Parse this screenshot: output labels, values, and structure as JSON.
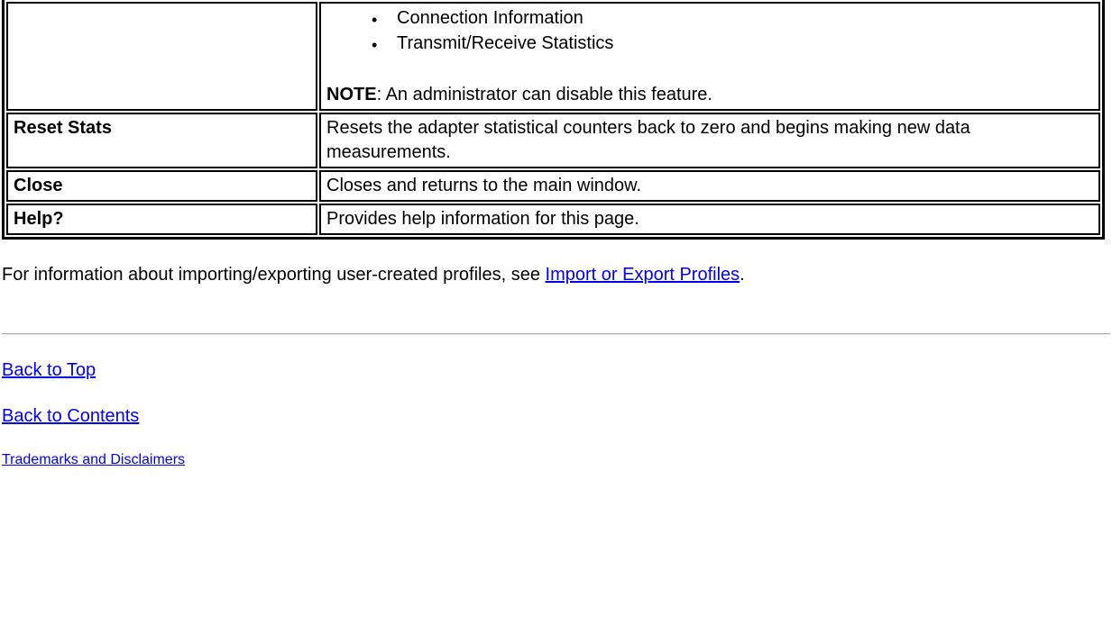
{
  "table": {
    "rows": [
      {
        "name": "",
        "bullets": [
          "Connection Information",
          "Transmit/Receive Statistics"
        ],
        "note_label": "NOTE",
        "note_text": ": An administrator can disable this feature."
      },
      {
        "name": "Reset Stats",
        "desc": "Resets the adapter statistical counters back to zero and begins making new data measurements."
      },
      {
        "name": "Close",
        "desc": "Closes and returns to the main window."
      },
      {
        "name": "Help?",
        "desc": "Provides help information for this page."
      }
    ]
  },
  "paragraph": {
    "pre": "For information about importing/exporting user-created profiles, see ",
    "link": "Import or Export Profiles",
    "post": "."
  },
  "nav": {
    "back_to_top": "Back to Top",
    "back_to_contents": "Back to Contents",
    "trademarks": "Trademarks and Disclaimers"
  }
}
